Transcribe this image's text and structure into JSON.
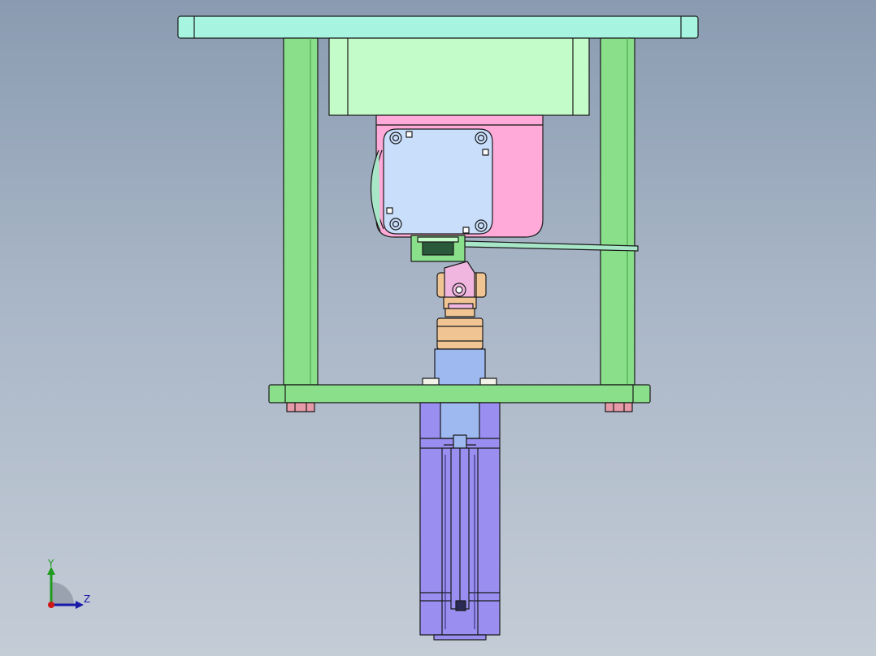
{
  "viewport": {
    "background_top": "#8a9bb1",
    "background_bottom": "#c4ccd6"
  },
  "triad": {
    "y_label": "Y",
    "z_label": "Z",
    "y_color": "#1e9a1e",
    "z_color": "#1a1aa8",
    "x_color": "#d01818"
  },
  "parts": {
    "top_plate_color": "#a7f5e1",
    "columns_color": "#8ae08a",
    "motor_housing_color": "#c3fbc9",
    "reducer_color": "#ffaad8",
    "motor_face_color": "#c8defb",
    "base_plate_color": "#8ae08a",
    "coupling_color": "#f0c493",
    "shaft_color": "#9eb9ef",
    "cylinder_color": "#9a8ff0",
    "nut_color": "#e79aa8",
    "rod_color": "#a8e6c8"
  }
}
